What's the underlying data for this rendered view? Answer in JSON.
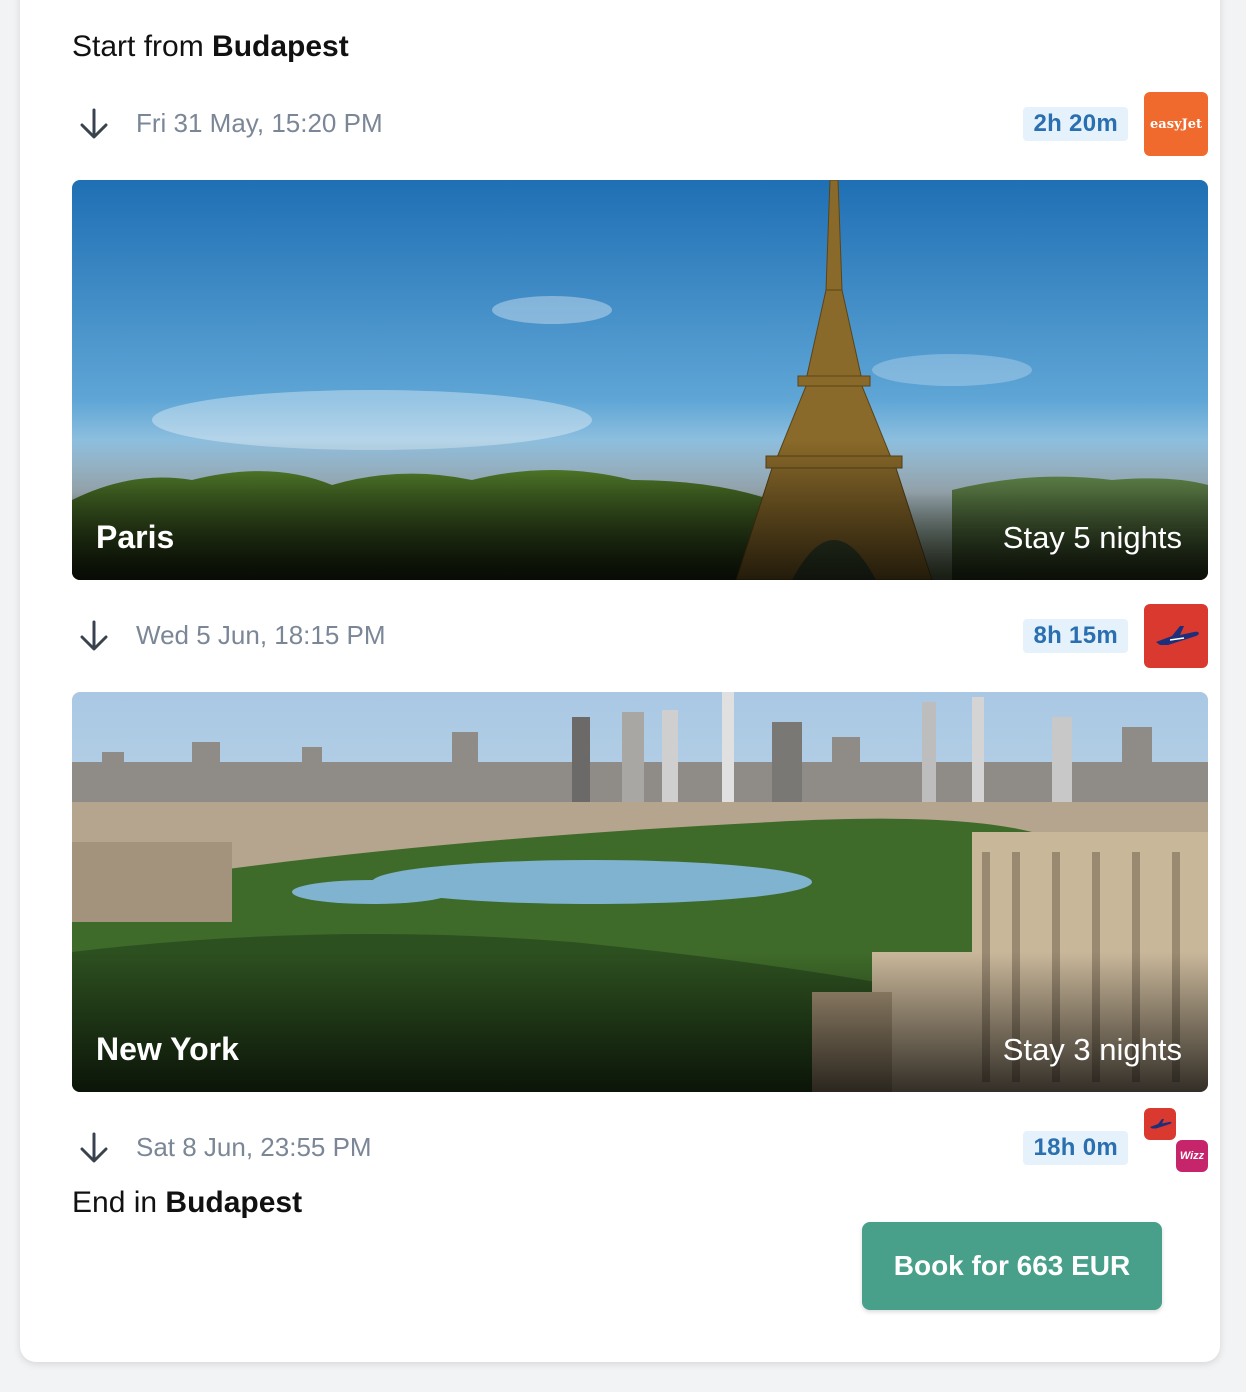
{
  "trip": {
    "start_prefix": "Start from",
    "start_city": "Budapest",
    "end_prefix": "End in",
    "end_city": "Budapest"
  },
  "legs": [
    {
      "date": "Fri 31 May, 15:20 PM",
      "duration": "2h 20m",
      "airline_logo": "easyJet"
    },
    {
      "date": "Wed 5 Jun, 18:15 PM",
      "duration": "8h 15m",
      "airline_logo": "plane-icon"
    },
    {
      "date": "Sat 8 Jun, 23:55 PM",
      "duration": "18h 0m",
      "airline_logos": [
        "plane-icon",
        "Wizz"
      ]
    }
  ],
  "destinations": [
    {
      "city": "Paris",
      "stay": "Stay 5 nights"
    },
    {
      "city": "New York",
      "stay": "Stay 3 nights"
    }
  ],
  "book_label": "Book for 663 EUR",
  "colors": {
    "accent_button": "#48a08a",
    "duration_badge_bg": "#e6f2fb",
    "duration_badge_text": "#2a6fb0",
    "easyjet": "#ef6a2c",
    "plane_logo": "#d9392f",
    "wizz": "#c6256b"
  }
}
